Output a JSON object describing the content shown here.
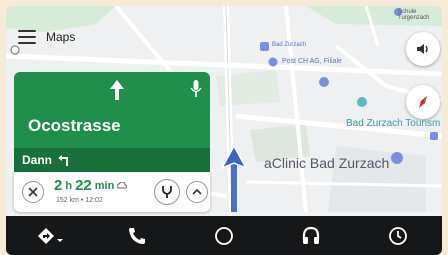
{
  "header": {
    "app_title": "Maps"
  },
  "navigation": {
    "street": "Ocostrasse",
    "then_label": "Dann",
    "eta_hours": "2",
    "eta_h_unit": "h",
    "eta_minutes": "22",
    "eta_min_unit": "min",
    "distance": "152 km",
    "separator": "•",
    "arrival": "12:02"
  },
  "map_labels": {
    "school": "Schule Turgenzach",
    "bad_zurzach": "Bad Zurzach",
    "post": "Post CH AG, Filiale",
    "bad_zurzach_tourism": "Bad Zurzach Tourism",
    "clinic": "aClinic Bad Zurzach"
  },
  "colors": {
    "nav_green": "#1f8f4b",
    "nav_green_dark": "#17703a",
    "route_blue": "#4d72c8",
    "dock_bg": "#151718",
    "compass_red": "#d93025"
  },
  "icons": [
    "menu-icon",
    "volume-icon",
    "compass-icon",
    "turn-straight-arrow-icon",
    "microphone-icon",
    "turn-left-icon",
    "close-icon",
    "route-options-icon",
    "chevron-up-icon",
    "directions-icon",
    "phone-icon",
    "home-circle-icon",
    "headphones-icon",
    "recent-icon"
  ]
}
